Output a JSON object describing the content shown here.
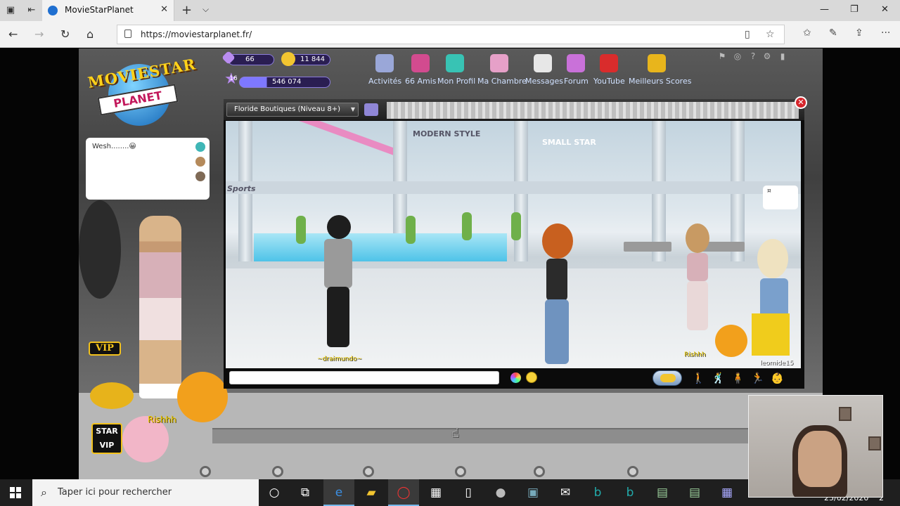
{
  "browser": {
    "tab_title": "MovieStarPlanet",
    "tab_close": "✕",
    "new_tab": "+",
    "tab_menu": "⌵",
    "url": "https://moviestarplanet.fr/",
    "window": {
      "minimize": "—",
      "maximize": "❐",
      "close": "✕"
    },
    "nav": {
      "back": "←",
      "forward": "→",
      "refresh": "↻",
      "home": "⌂"
    },
    "toolbar_icons": {
      "reading": "▯",
      "favorite": "☆",
      "favorites_hub": "✩",
      "notes": "✎",
      "share": "⇪",
      "more": "···"
    }
  },
  "game": {
    "logo": {
      "line1": "MOVIESTAR",
      "line2": "PLANET"
    },
    "hud": {
      "diamonds": "66",
      "coins": "11 844",
      "level": "16",
      "fame": "546 074"
    },
    "menu": [
      {
        "label": "Activités",
        "icon": "activities-icon",
        "color": "#9aa7d8"
      },
      {
        "label": "66 Amis",
        "icon": "friends-icon",
        "color": "#d24b8f"
      },
      {
        "label": "Mon Profil",
        "icon": "profile-icon",
        "color": "#38c3b4"
      },
      {
        "label": "Ma Chambre",
        "icon": "room-icon",
        "color": "#e6a0c8"
      },
      {
        "label": "Messages",
        "icon": "messages-icon",
        "color": "#e7e7e7"
      },
      {
        "label": "Forum",
        "icon": "forum-icon",
        "color": "#c971d9"
      },
      {
        "label": "YouTube",
        "icon": "youtube-icon",
        "color": "#d92c2c"
      },
      {
        "label": "Meilleurs Scores",
        "icon": "trophy-icon",
        "color": "#e8b51c"
      }
    ],
    "system_icons": [
      "⚑",
      "◎",
      "?",
      "⚙",
      "▮"
    ],
    "chat_bubble": "Wesh........😀",
    "vip_badge": "VIP",
    "star_vip": {
      "line1": "STAR",
      "line2": "VIP"
    },
    "player_name": "Rishhh",
    "room": {
      "name": "Floride Boutiques (Niveau 8+)",
      "dropdown_arrow": "▼",
      "close": "✕",
      "signs": {
        "modern": "MODERN STYLE",
        "sports": "Sports",
        "small_star": "SMALL STAR"
      },
      "room_bubble": "¤",
      "characters": [
        {
          "name": "~draimundo~"
        },
        {
          "name": ""
        },
        {
          "name": "Rishhh"
        },
        {
          "name": "leomide15"
        }
      ]
    },
    "chat_placeholder": "",
    "emote_icons": [
      "🚶",
      "🕺",
      "🧍",
      "🏃",
      "👶"
    ]
  },
  "taskbar": {
    "search_placeholder": "Taper ici pour rechercher",
    "date": "25/02/2020",
    "notification_badge": "2"
  }
}
